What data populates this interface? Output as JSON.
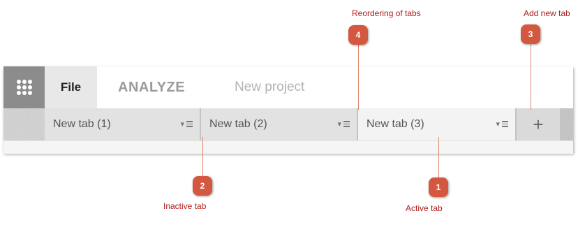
{
  "menubar": {
    "apps_icon": "grid-dots-icon",
    "file_label": "File",
    "analyze_label": "ANALYZE",
    "project_name": "New project"
  },
  "tabs": [
    {
      "label": "New tab (1)",
      "state": "inactive"
    },
    {
      "label": "New tab (2)",
      "state": "inactive"
    },
    {
      "label": "New tab (3)",
      "state": "active"
    }
  ],
  "add_tab": {
    "label": "+"
  },
  "callouts": [
    {
      "number": "1",
      "label": "Active tab"
    },
    {
      "number": "2",
      "label": "Inactive tab"
    },
    {
      "number": "3",
      "label": "Add new tab"
    },
    {
      "number": "4",
      "label": "Reordering of tabs"
    }
  ],
  "colors": {
    "callout_marker": "#d3583f",
    "callout_text": "#b01d1d",
    "apps_button": "#8c8c8c"
  }
}
